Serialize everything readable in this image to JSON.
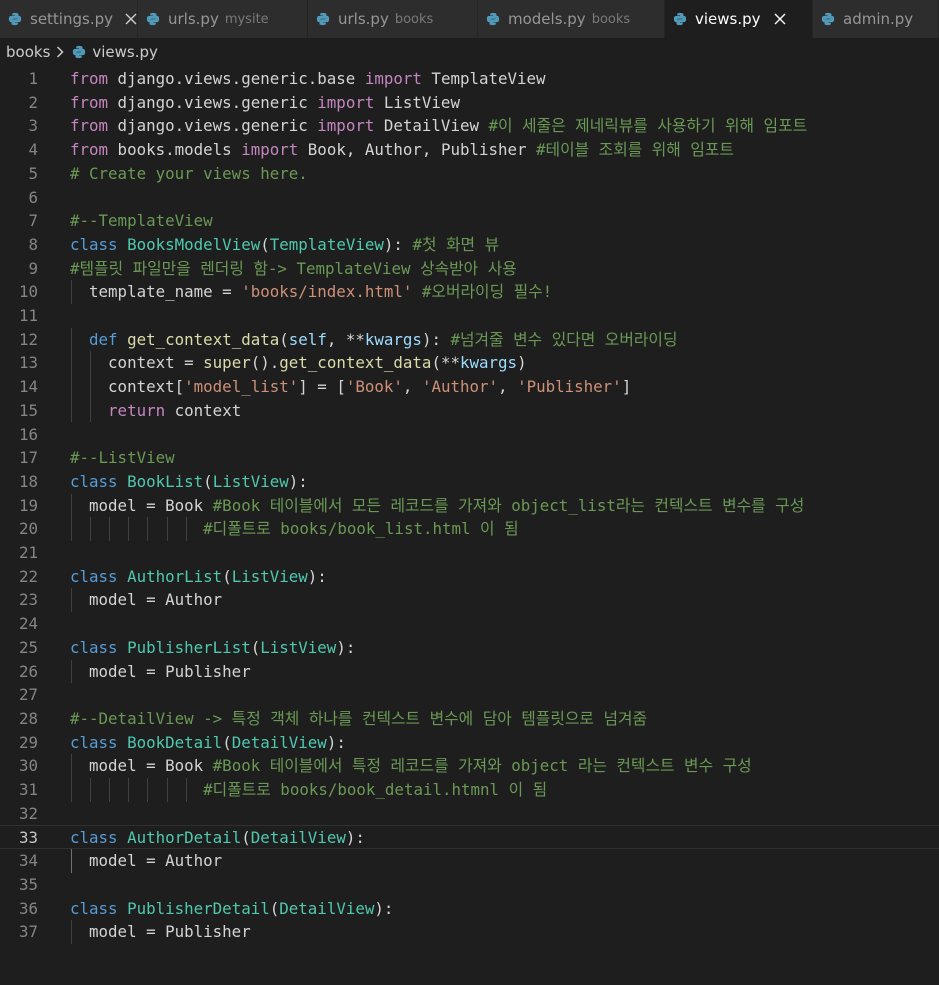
{
  "tabs": [
    {
      "name": "settings.py",
      "desc": "",
      "active": false,
      "close": true
    },
    {
      "name": "urls.py",
      "desc": "mysite",
      "active": false,
      "close": false
    },
    {
      "name": "urls.py",
      "desc": "books",
      "active": false,
      "close": false
    },
    {
      "name": "models.py",
      "desc": "books",
      "active": false,
      "close": false
    },
    {
      "name": "views.py",
      "desc": "",
      "active": true,
      "close": true
    },
    {
      "name": "admin.py",
      "desc": "",
      "active": false,
      "close": false
    }
  ],
  "breadcrumb": {
    "folder": "books",
    "file": "views.py"
  },
  "editor": {
    "current_line": 33,
    "lines": [
      {
        "n": "1",
        "tokens": [
          [
            "kw2",
            "from"
          ],
          [
            "op",
            " django.views.generic.base "
          ],
          [
            "kw2",
            "import"
          ],
          [
            "op",
            " TemplateView"
          ]
        ]
      },
      {
        "n": "2",
        "tokens": [
          [
            "kw2",
            "from"
          ],
          [
            "op",
            " django.views.generic "
          ],
          [
            "kw2",
            "import"
          ],
          [
            "op",
            " ListView"
          ]
        ]
      },
      {
        "n": "3",
        "tokens": [
          [
            "kw2",
            "from"
          ],
          [
            "op",
            " django.views.generic "
          ],
          [
            "kw2",
            "import"
          ],
          [
            "op",
            " DetailView "
          ],
          [
            "cm",
            "#이 세줄은 제네릭뷰를 사용하기 위해 임포트"
          ]
        ]
      },
      {
        "n": "4",
        "tokens": [
          [
            "kw2",
            "from"
          ],
          [
            "op",
            " books.models "
          ],
          [
            "kw2",
            "import"
          ],
          [
            "op",
            " Book, Author, Publisher "
          ],
          [
            "cm",
            "#테이블 조회를 위해 임포트"
          ]
        ]
      },
      {
        "n": "5",
        "tokens": [
          [
            "cm",
            "# Create your views here."
          ]
        ]
      },
      {
        "n": "6",
        "tokens": []
      },
      {
        "n": "7",
        "tokens": [
          [
            "cm",
            "#--TemplateView"
          ]
        ]
      },
      {
        "n": "8",
        "tokens": [
          [
            "kw",
            "class"
          ],
          [
            "op",
            " "
          ],
          [
            "cls",
            "BooksModelView"
          ],
          [
            "op",
            "("
          ],
          [
            "cls",
            "TemplateView"
          ],
          [
            "op",
            "): "
          ],
          [
            "cm",
            "#첫 화면 뷰"
          ]
        ]
      },
      {
        "n": "9",
        "tokens": [
          [
            "cm",
            "#템플릿 파일만을 렌더링 함-> TemplateView 상속받아 사용"
          ]
        ]
      },
      {
        "n": "10",
        "guides": [
          1
        ],
        "tokens": [
          [
            "op",
            "  template_name = "
          ],
          [
            "str",
            "'books/index.html'"
          ],
          [
            "op",
            " "
          ],
          [
            "cm",
            "#오버라이딩 필수!"
          ]
        ]
      },
      {
        "n": "11",
        "tokens": []
      },
      {
        "n": "12",
        "guides": [
          1
        ],
        "tokens": [
          [
            "op",
            "  "
          ],
          [
            "kw",
            "def"
          ],
          [
            "op",
            " "
          ],
          [
            "fn",
            "get_context_data"
          ],
          [
            "op",
            "("
          ],
          [
            "var",
            "self"
          ],
          [
            "op",
            ", **"
          ],
          [
            "var",
            "kwargs"
          ],
          [
            "op",
            "): "
          ],
          [
            "cm",
            "#넘겨줄 변수 있다면 오버라이딩"
          ]
        ]
      },
      {
        "n": "13",
        "guides": [
          1,
          2
        ],
        "tokens": [
          [
            "op",
            "    context = "
          ],
          [
            "fn",
            "super"
          ],
          [
            "op",
            "()."
          ],
          [
            "fn",
            "get_context_data"
          ],
          [
            "op",
            "(**"
          ],
          [
            "var",
            "kwargs"
          ],
          [
            "op",
            ")"
          ]
        ]
      },
      {
        "n": "14",
        "guides": [
          1,
          2
        ],
        "tokens": [
          [
            "op",
            "    context["
          ],
          [
            "str",
            "'model_list'"
          ],
          [
            "op",
            "] = ["
          ],
          [
            "str",
            "'Book'"
          ],
          [
            "op",
            ", "
          ],
          [
            "str",
            "'Author'"
          ],
          [
            "op",
            ", "
          ],
          [
            "str",
            "'Publisher'"
          ],
          [
            "op",
            "]"
          ]
        ]
      },
      {
        "n": "15",
        "guides": [
          1,
          2
        ],
        "tokens": [
          [
            "op",
            "    "
          ],
          [
            "kw2",
            "return"
          ],
          [
            "op",
            " context"
          ]
        ]
      },
      {
        "n": "16",
        "tokens": []
      },
      {
        "n": "17",
        "tokens": [
          [
            "cm",
            "#--ListView"
          ]
        ]
      },
      {
        "n": "18",
        "tokens": [
          [
            "kw",
            "class"
          ],
          [
            "op",
            " "
          ],
          [
            "cls",
            "BookList"
          ],
          [
            "op",
            "("
          ],
          [
            "cls",
            "ListView"
          ],
          [
            "op",
            "):"
          ]
        ]
      },
      {
        "n": "19",
        "guides": [
          1
        ],
        "tokens": [
          [
            "op",
            "  model = Book "
          ],
          [
            "cm",
            "#Book 테이블에서 모든 레코드를 가져와 object_list라는 컨텍스트 변수를 구성"
          ]
        ]
      },
      {
        "n": "20",
        "guides": [
          1,
          2,
          3,
          4,
          5,
          6,
          7
        ],
        "tokens": [
          [
            "op",
            "              "
          ],
          [
            "cm",
            "#디폴트로 books/book_list.html 이 됨"
          ]
        ]
      },
      {
        "n": "21",
        "tokens": []
      },
      {
        "n": "22",
        "tokens": [
          [
            "kw",
            "class"
          ],
          [
            "op",
            " "
          ],
          [
            "cls",
            "AuthorList"
          ],
          [
            "op",
            "("
          ],
          [
            "cls",
            "ListView"
          ],
          [
            "op",
            "):"
          ]
        ]
      },
      {
        "n": "23",
        "guides": [
          1
        ],
        "tokens": [
          [
            "op",
            "  model = Author"
          ]
        ]
      },
      {
        "n": "24",
        "tokens": []
      },
      {
        "n": "25",
        "tokens": [
          [
            "kw",
            "class"
          ],
          [
            "op",
            " "
          ],
          [
            "cls",
            "PublisherList"
          ],
          [
            "op",
            "("
          ],
          [
            "cls",
            "ListView"
          ],
          [
            "op",
            "):"
          ]
        ]
      },
      {
        "n": "26",
        "guides": [
          1
        ],
        "tokens": [
          [
            "op",
            "  model = Publisher"
          ]
        ]
      },
      {
        "n": "27",
        "tokens": []
      },
      {
        "n": "28",
        "tokens": [
          [
            "cm",
            "#--DetailView -> 특정 객체 하나를 컨텍스트 변수에 담아 템플릿으로 넘겨줌"
          ]
        ]
      },
      {
        "n": "29",
        "tokens": [
          [
            "kw",
            "class"
          ],
          [
            "op",
            " "
          ],
          [
            "cls",
            "BookDetail"
          ],
          [
            "op",
            "("
          ],
          [
            "cls",
            "DetailView"
          ],
          [
            "op",
            "):"
          ]
        ]
      },
      {
        "n": "30",
        "guides": [
          1
        ],
        "tokens": [
          [
            "op",
            "  model = Book "
          ],
          [
            "cm",
            "#Book 테이블에서 특정 레코드를 가져와 object 라는 컨텍스트 변수 구성"
          ]
        ]
      },
      {
        "n": "31",
        "guides": [
          1,
          2,
          3,
          4,
          5,
          6,
          7
        ],
        "tokens": [
          [
            "op",
            "              "
          ],
          [
            "cm",
            "#디폴트로 books/book_detail.htmnl 이 됨"
          ]
        ]
      },
      {
        "n": "32",
        "tokens": []
      },
      {
        "n": "33",
        "tokens": [
          [
            "kw",
            "class"
          ],
          [
            "op",
            " "
          ],
          [
            "cls",
            "AuthorDetail"
          ],
          [
            "op",
            "("
          ],
          [
            "cls",
            "DetailView"
          ],
          [
            "op",
            "):"
          ]
        ]
      },
      {
        "n": "34",
        "guides": [
          1
        ],
        "activeGuide": true,
        "tokens": [
          [
            "op",
            "  model = Author"
          ]
        ]
      },
      {
        "n": "35",
        "tokens": []
      },
      {
        "n": "36",
        "tokens": [
          [
            "kw",
            "class"
          ],
          [
            "op",
            " "
          ],
          [
            "cls",
            "PublisherDetail"
          ],
          [
            "op",
            "("
          ],
          [
            "cls",
            "DetailView"
          ],
          [
            "op",
            "):"
          ]
        ]
      },
      {
        "n": "37",
        "guides": [
          1
        ],
        "tokens": [
          [
            "op",
            "  model = Publisher"
          ]
        ]
      }
    ]
  }
}
